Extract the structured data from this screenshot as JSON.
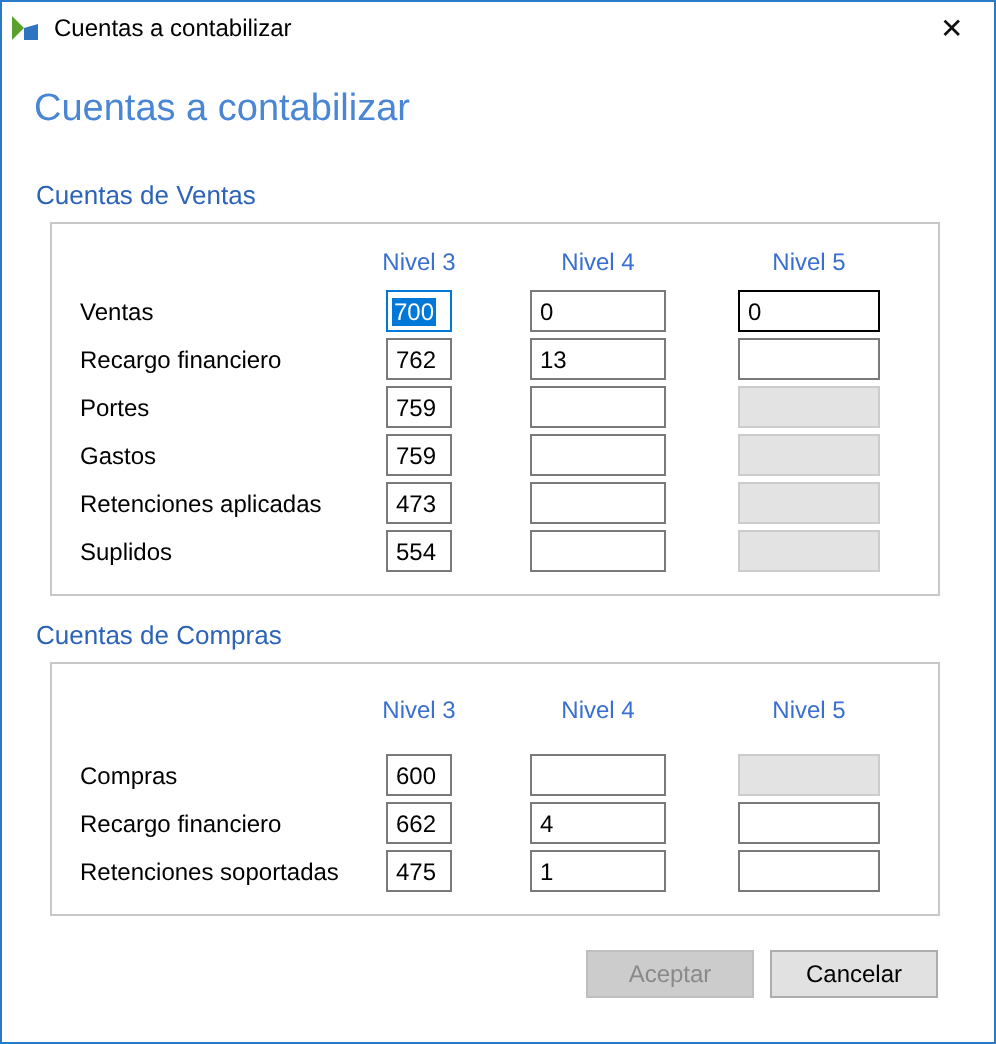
{
  "window": {
    "title": "Cuentas a contabilizar",
    "close": "✕"
  },
  "heading": "Cuentas a contabilizar",
  "sections": [
    {
      "title": "Cuentas de Ventas",
      "columns": [
        "Nivel 3",
        "Nivel 4",
        "Nivel 5"
      ],
      "rows": [
        {
          "label": "Ventas",
          "fields": [
            {
              "value": "700",
              "focused": true,
              "hovered": false,
              "disabled": false
            },
            {
              "value": "0",
              "focused": false,
              "hovered": false,
              "disabled": false
            },
            {
              "value": "0",
              "focused": false,
              "hovered": true,
              "disabled": false
            }
          ]
        },
        {
          "label": "Recargo financiero",
          "fields": [
            {
              "value": "762",
              "focused": false,
              "hovered": false,
              "disabled": false
            },
            {
              "value": "13",
              "focused": false,
              "hovered": false,
              "disabled": false
            },
            {
              "focused": false,
              "hovered": false,
              "disabled": false
            }
          ]
        },
        {
          "label": "Portes",
          "fields": [
            {
              "value": "759",
              "focused": false,
              "hovered": false,
              "disabled": false
            },
            {
              "focused": false,
              "hovered": false,
              "disabled": false
            },
            {
              "focused": false,
              "hovered": false,
              "disabled": true
            }
          ]
        },
        {
          "label": "Gastos",
          "fields": [
            {
              "value": "759",
              "focused": false,
              "hovered": false,
              "disabled": false
            },
            {
              "focused": false,
              "hovered": false,
              "disabled": false
            },
            {
              "focused": false,
              "hovered": false,
              "disabled": true
            }
          ]
        },
        {
          "label": "Retenciones aplicadas",
          "fields": [
            {
              "value": "473",
              "focused": false,
              "hovered": false,
              "disabled": false
            },
            {
              "focused": false,
              "hovered": false,
              "disabled": false
            },
            {
              "focused": false,
              "hovered": false,
              "disabled": true
            }
          ]
        },
        {
          "label": "Suplidos",
          "fields": [
            {
              "value": "554",
              "focused": false,
              "hovered": false,
              "disabled": false
            },
            {
              "focused": false,
              "hovered": false,
              "disabled": false
            },
            {
              "focused": false,
              "hovered": false,
              "disabled": true
            }
          ]
        }
      ]
    },
    {
      "title": "Cuentas de Compras",
      "columns": [
        "Nivel 3",
        "Nivel 4",
        "Nivel 5"
      ],
      "rows": [
        {
          "label": "Compras",
          "fields": [
            {
              "value": "600",
              "focused": false,
              "hovered": false,
              "disabled": false
            },
            {
              "focused": false,
              "hovered": false,
              "disabled": false
            },
            {
              "focused": false,
              "hovered": false,
              "disabled": true
            }
          ]
        },
        {
          "label": "Recargo financiero",
          "fields": [
            {
              "value": "662",
              "focused": false,
              "hovered": false,
              "disabled": false
            },
            {
              "value": "4",
              "focused": false,
              "hovered": false,
              "disabled": false
            },
            {
              "focused": false,
              "hovered": false,
              "disabled": false
            }
          ]
        },
        {
          "label": "Retenciones soportadas",
          "fields": [
            {
              "value": "475",
              "focused": false,
              "hovered": false,
              "disabled": false
            },
            {
              "value": "1",
              "focused": false,
              "hovered": false,
              "disabled": false
            },
            {
              "focused": false,
              "hovered": false,
              "disabled": false
            }
          ]
        }
      ]
    }
  ],
  "buttons": [
    {
      "label": "Aceptar",
      "disabled": true
    },
    {
      "label": "Cancelar",
      "disabled": false
    }
  ]
}
